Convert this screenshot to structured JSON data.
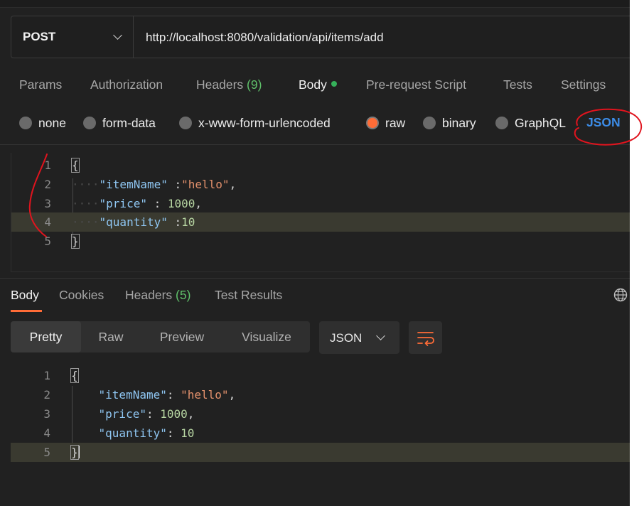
{
  "request": {
    "method": "POST",
    "url": "http://localhost:8080/validation/api/items/add",
    "tabs": [
      {
        "label": "Params"
      },
      {
        "label": "Authorization"
      },
      {
        "label": "Headers",
        "count": "(9)"
      },
      {
        "label": "Body"
      },
      {
        "label": "Pre-request Script"
      },
      {
        "label": "Tests"
      },
      {
        "label": "Settings"
      }
    ],
    "body_types": [
      "none",
      "form-data",
      "x-www-form-urlencoded",
      "raw",
      "binary",
      "GraphQL"
    ],
    "selected_body_type": "raw",
    "raw_format": "JSON",
    "body_lines": [
      {
        "n": "1",
        "text": "{"
      },
      {
        "n": "2",
        "key": "\"itemName\"",
        "sep": " :",
        "value": "\"hello\"",
        "end": ","
      },
      {
        "n": "3",
        "key": "\"price\"",
        "sep": " : ",
        "value": "1000",
        "end": ","
      },
      {
        "n": "4",
        "key": "\"quantity\"",
        "sep": " :",
        "value": "10",
        "end": ""
      },
      {
        "n": "5",
        "text": "}"
      }
    ]
  },
  "response": {
    "tabs": [
      {
        "label": "Body"
      },
      {
        "label": "Cookies"
      },
      {
        "label": "Headers",
        "count": "(5)"
      },
      {
        "label": "Test Results"
      }
    ],
    "view_modes": [
      "Pretty",
      "Raw",
      "Preview",
      "Visualize"
    ],
    "active_view_mode": "Pretty",
    "format": "JSON",
    "body_lines": [
      {
        "n": "1",
        "text": "{"
      },
      {
        "n": "2",
        "key": "\"itemName\"",
        "sep": ": ",
        "value": "\"hello\"",
        "end": ","
      },
      {
        "n": "3",
        "key": "\"price\"",
        "sep": ": ",
        "value": "1000",
        "end": ","
      },
      {
        "n": "4",
        "key": "\"quantity\"",
        "sep": ": ",
        "value": "10",
        "end": ""
      },
      {
        "n": "5",
        "text": "}"
      }
    ]
  },
  "colors": {
    "accent": "#ff6c37",
    "json_blue": "#3c8ce7",
    "count_green": "#5fc06a",
    "annotation_red": "#e0141e"
  }
}
